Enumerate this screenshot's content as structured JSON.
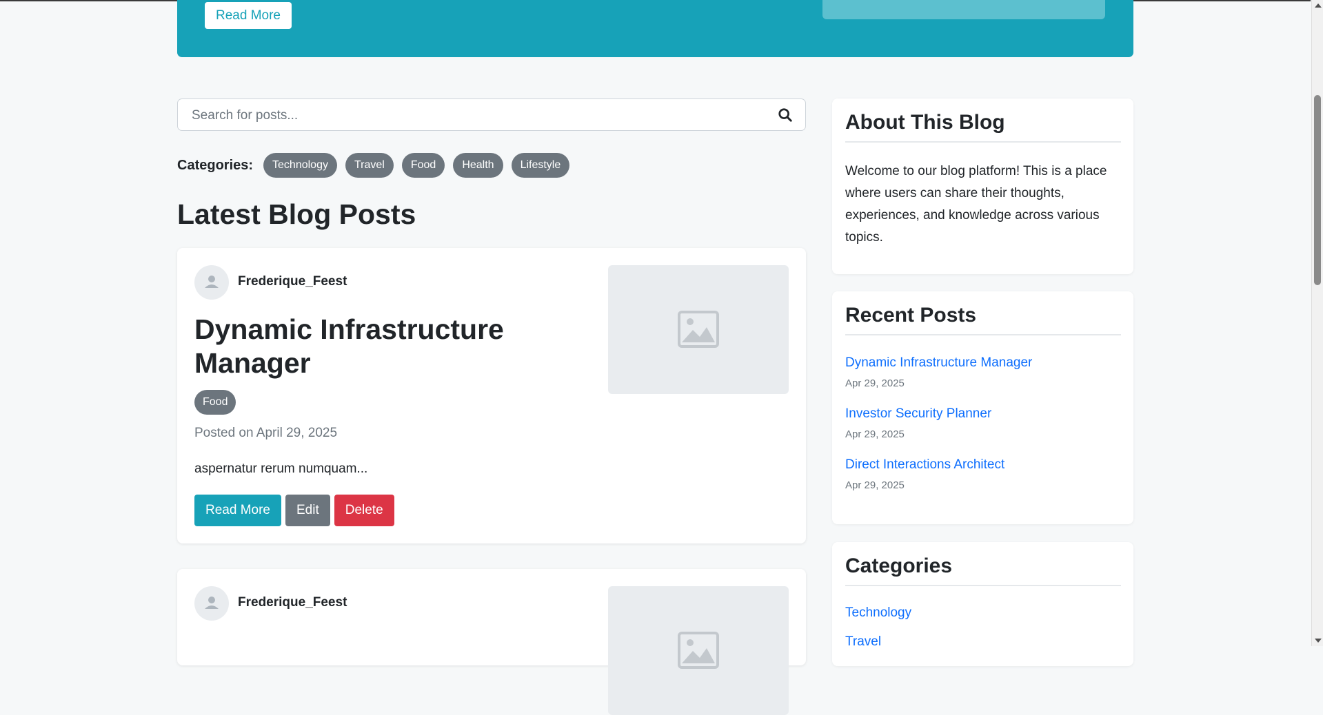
{
  "hero": {
    "read_more_label": "Read More",
    "accent_color": "#17a2b8"
  },
  "search": {
    "placeholder": "Search for posts...",
    "icon": "search-icon"
  },
  "categories_bar": {
    "label": "Categories:",
    "items": [
      "Technology",
      "Travel",
      "Food",
      "Health",
      "Lifestyle"
    ]
  },
  "main": {
    "title": "Latest Blog Posts"
  },
  "posts": [
    {
      "author": "Frederique_Feest",
      "title": "Dynamic Infrastructure Manager",
      "tag": "Food",
      "posted": "Posted on April 29, 2025",
      "excerpt": "aspernatur rerum numquam...",
      "actions": {
        "read_more": "Read More",
        "edit": "Edit",
        "delete": "Delete"
      }
    },
    {
      "author": "Frederique_Feest"
    }
  ],
  "sidebar": {
    "about": {
      "title": "About This Blog",
      "text": "Welcome to our blog platform! This is a place where users can share their thoughts, experiences, and knowledge across various topics."
    },
    "recent": {
      "title": "Recent Posts",
      "items": [
        {
          "title": "Dynamic Infrastructure Manager",
          "date": "Apr 29, 2025"
        },
        {
          "title": "Investor Security Planner",
          "date": "Apr 29, 2025"
        },
        {
          "title": "Direct Interactions Architect",
          "date": "Apr 29, 2025"
        }
      ]
    },
    "categories": {
      "title": "Categories",
      "items": [
        "Technology",
        "Travel"
      ]
    }
  },
  "colors": {
    "primary_link": "#0d6efd",
    "danger": "#dc3545",
    "secondary": "#6c757d",
    "info": "#17a2b8"
  }
}
